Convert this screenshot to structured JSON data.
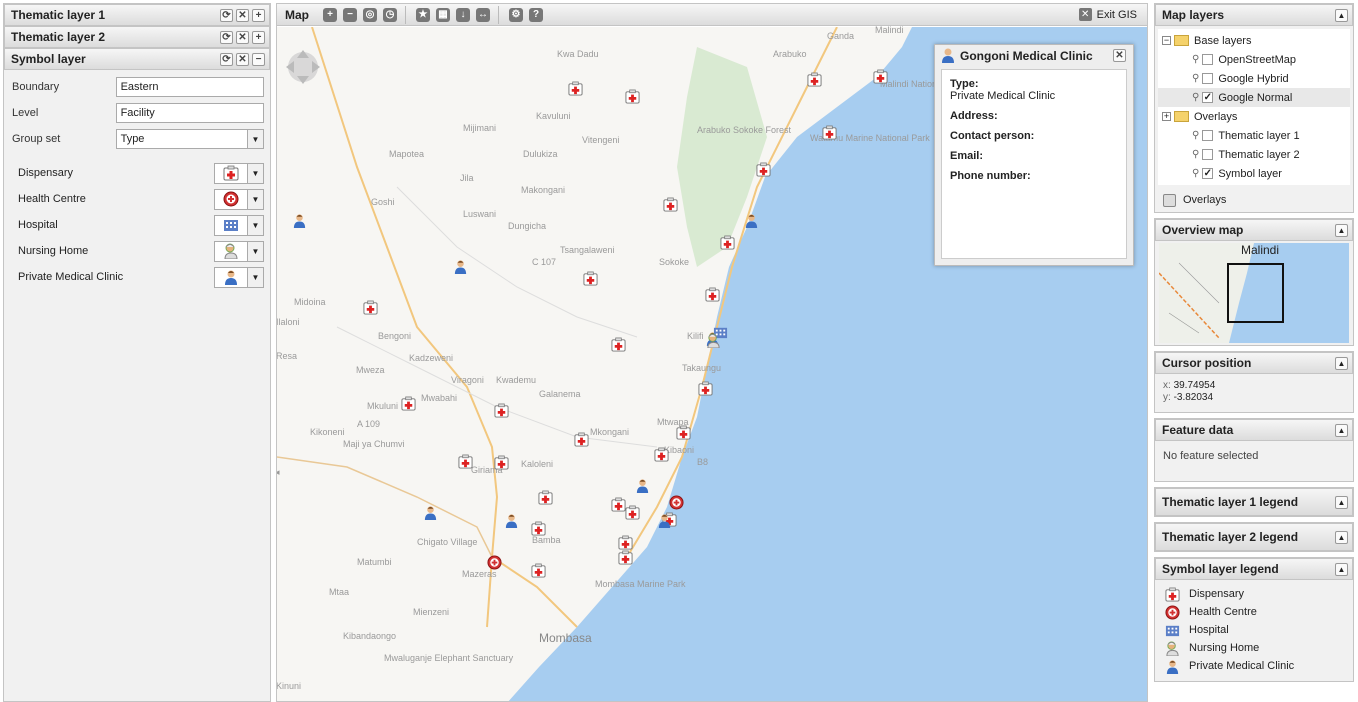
{
  "left": {
    "panels": [
      {
        "title": "Thematic layer 1"
      },
      {
        "title": "Thematic layer 2"
      },
      {
        "title": "Symbol layer"
      }
    ],
    "form": {
      "boundary_label": "Boundary",
      "boundary_value": "Eastern",
      "level_label": "Level",
      "level_value": "Facility",
      "groupset_label": "Group set",
      "groupset_value": "Type"
    },
    "symbols": [
      {
        "label": "Dispensary",
        "icon": "dispensary-icon"
      },
      {
        "label": "Health Centre",
        "icon": "health-centre-icon"
      },
      {
        "label": "Hospital",
        "icon": "hospital-icon"
      },
      {
        "label": "Nursing Home",
        "icon": "nursing-home-icon"
      },
      {
        "label": "Private Medical Clinic",
        "icon": "private-clinic-icon"
      }
    ]
  },
  "map": {
    "title": "Map",
    "exit_label": "Exit GIS",
    "popup": {
      "title": "Gongoni Medical Clinic",
      "type_label": "Type:",
      "type_value": "Private Medical Clinic",
      "address_label": "Address:",
      "contact_label": "Contact person:",
      "email_label": "Email:",
      "phone_label": "Phone number:"
    },
    "places": [
      "Kwa Dadu",
      "Arabuko",
      "Ganda",
      "Malindi",
      "Malindi National Park",
      "Kavuluni",
      "Mijimani",
      "Vitengeni",
      "Arabuko Sokoke Forest",
      "Watamu Marine National Park",
      "Mapotea",
      "Dulukiza",
      "Jila",
      "Makongani",
      "Goshi",
      "Luswani",
      "Dungicha",
      "Tsangalaweni",
      "Sokoke",
      "Midoina",
      "Bengoni",
      "Kadzeweni",
      "Mweza",
      "Viragoni",
      "Kwademu",
      "Mwabahi",
      "Mkuluni",
      "Galanema",
      "Maji ya Chumvi",
      "Mkongani",
      "Kaloleni",
      "Giriama",
      "Bamba",
      "Chigato Village",
      "Mazeras",
      "Matumbi",
      "Mtaa",
      "Mienzeni",
      "Kibandaongo",
      "Mombasa Marine Park",
      "Mombasa",
      "Mwaluganje Elephant Sanctuary",
      "Kikoneni",
      "Kilifi",
      "Takaungu",
      "Kibaoni",
      "Mtwapa",
      "A 109",
      "B8",
      "C 107",
      "Ilaloni",
      "Resa",
      "Kinuni"
    ]
  },
  "right": {
    "map_layers": {
      "title": "Map layers",
      "base_label": "Base layers",
      "base": [
        {
          "label": "OpenStreetMap",
          "checked": false
        },
        {
          "label": "Google Hybrid",
          "checked": false
        },
        {
          "label": "Google Normal",
          "checked": true
        }
      ],
      "overlays_label": "Overlays",
      "overlays": [
        {
          "label": "Thematic layer 1",
          "checked": false
        },
        {
          "label": "Thematic layer 2",
          "checked": false
        },
        {
          "label": "Symbol layer",
          "checked": true
        }
      ],
      "footer_label": "Overlays"
    },
    "overview": {
      "title": "Overview map",
      "town": "Malindi"
    },
    "cursor": {
      "title": "Cursor position",
      "x_label": "x:",
      "x_value": "39.74954",
      "y_label": "y:",
      "y_value": "-3.82034"
    },
    "feature": {
      "title": "Feature data",
      "text": "No feature selected"
    },
    "legend1": {
      "title": "Thematic layer 1 legend"
    },
    "legend2": {
      "title": "Thematic layer 2 legend"
    },
    "symlegend": {
      "title": "Symbol layer legend",
      "items": [
        {
          "label": "Dispensary",
          "icon": "dispensary-icon"
        },
        {
          "label": "Health Centre",
          "icon": "health-centre-icon"
        },
        {
          "label": "Hospital",
          "icon": "hospital-icon"
        },
        {
          "label": "Nursing Home",
          "icon": "nursing-home-icon"
        },
        {
          "label": "Private Medical Clinic",
          "icon": "private-clinic-icon"
        }
      ]
    }
  },
  "colors": {
    "sea": "#a7cdf0",
    "land": "#f7f6f3",
    "forest": "#d6e8cf",
    "road": "#f2c77e",
    "red": "#cc2a2a"
  }
}
